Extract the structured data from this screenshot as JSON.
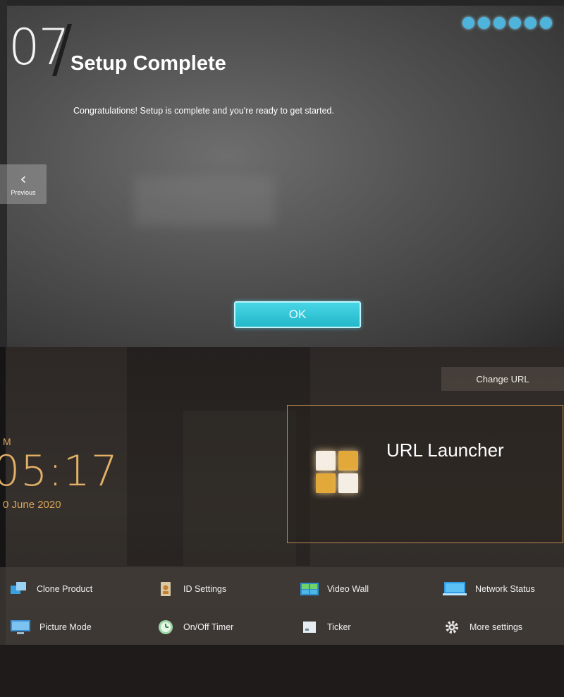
{
  "setup": {
    "step_number": "07",
    "title": "Setup Complete",
    "description": "Congratulations! Setup is complete and you're ready to get started.",
    "step_indicators": 6,
    "previous_label": "Previous",
    "previous_icon": "chevron-left-icon",
    "ok_label": "OK",
    "colors": {
      "accent": "#2fc4d6",
      "dots": "#4fb4dc"
    }
  },
  "home": {
    "change_url_label": "Change URL",
    "clock": {
      "ampm": "M",
      "time": "05:17",
      "date": "0 June 2020"
    },
    "url_launcher": {
      "title": "URL Launcher",
      "icon": "grid-tiles-icon",
      "tile_color": "#e2a83a"
    },
    "menu": [
      {
        "label": "Clone Product",
        "icon": "clone-product-icon"
      },
      {
        "label": "ID Settings",
        "icon": "id-settings-icon"
      },
      {
        "label": "Video Wall",
        "icon": "video-wall-icon"
      },
      {
        "label": "Network Status",
        "icon": "network-status-icon"
      },
      {
        "label": "Picture Mode",
        "icon": "picture-mode-icon"
      },
      {
        "label": "On/Off Timer",
        "icon": "on-off-timer-icon"
      },
      {
        "label": "Ticker",
        "icon": "ticker-icon"
      },
      {
        "label": "More settings",
        "icon": "gear-icon"
      }
    ],
    "colors": {
      "clock": "#e2b067",
      "card_border": "#b9874d"
    }
  }
}
